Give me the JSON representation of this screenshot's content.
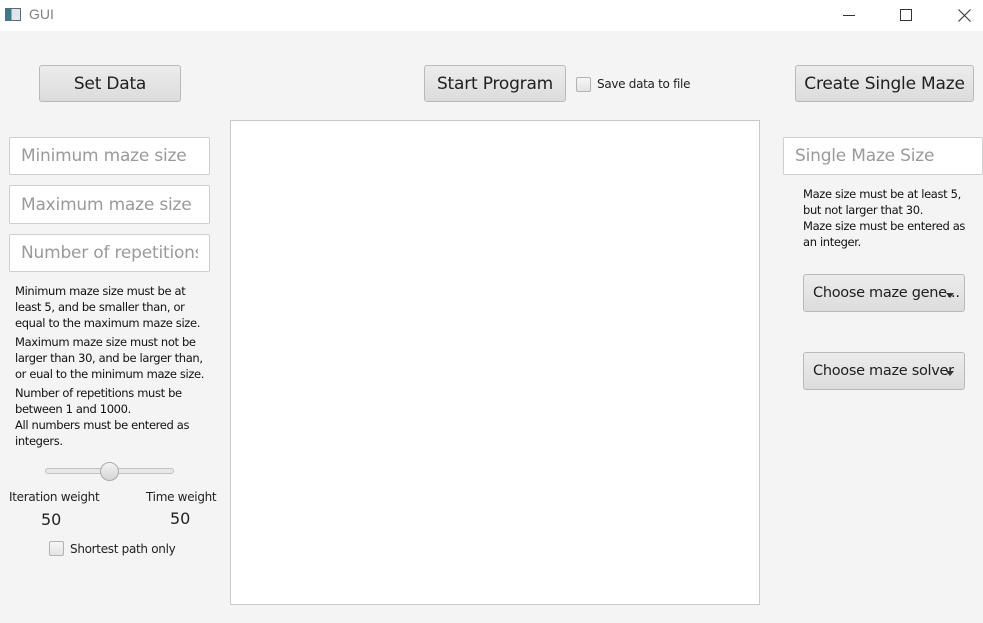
{
  "window": {
    "title": "GUI",
    "icon": "app-window-icon",
    "controls": [
      "minimize-icon",
      "maximize-icon",
      "close-icon"
    ]
  },
  "toolbar": {
    "set_data_label": "Set Data",
    "start_program_label": "Start Program",
    "save_data_label": "Save data to file",
    "create_single_maze_label": "Create Single Maze"
  },
  "left_panel": {
    "min_size_placeholder": "Minimum maze size",
    "max_size_placeholder": "Maximum maze size",
    "repetitions_placeholder": "Number of repetitions",
    "help_1": "Minimum maze size must be at\nleast 5, and be smaller than, or\nequal to the maximum maze size.",
    "help_2": "Maximum maze size must not be\nlarger than 30, and be larger than,\nor eual to the minimum maze size.",
    "help_3": "Number of repetitions must be\nbetween 1 and 1000.\nAll numbers must be entered as\nintegers.",
    "slider_value": 50,
    "iteration_weight_label": "Iteration weight",
    "time_weight_label": "Time weight",
    "iteration_weight_value": "50",
    "time_weight_value": "50",
    "shortest_path_label": "Shortest path only"
  },
  "right_panel": {
    "single_size_placeholder": "Single Maze Size",
    "help": "Maze size must be at least 5,\nbut not larger that 30.\nMaze size must be entered as\nan integer.",
    "generator_dropdown": "Choose maze gene...",
    "solver_dropdown": "Choose maze solver"
  }
}
